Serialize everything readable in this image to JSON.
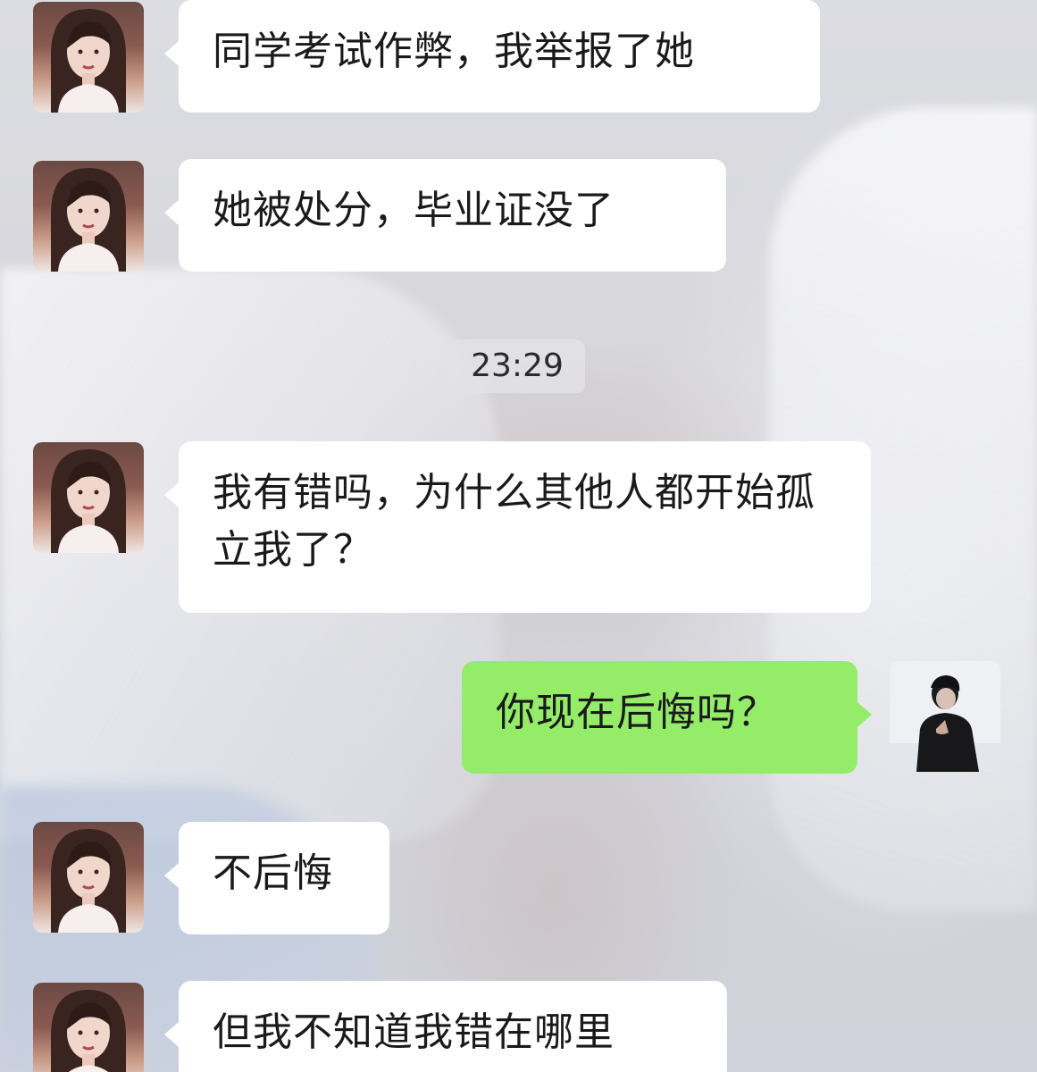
{
  "chat": {
    "messages": [
      {
        "side": "left",
        "text": "同学考试作弊，我举报了她"
      },
      {
        "side": "left",
        "text": "她被处分，毕业证没了"
      },
      {
        "side": "left",
        "text": "我有错吗，为什么其他人都开始孤立我了？"
      },
      {
        "side": "right",
        "text": "你现在后悔吗？"
      },
      {
        "side": "left",
        "text": "不后悔"
      },
      {
        "side": "left",
        "text": "但我不知道我错在哪里"
      }
    ],
    "timestamp": "23:29"
  },
  "colors": {
    "incoming_bubble": "#ffffff",
    "outgoing_bubble": "#95ec69",
    "timestamp_bg": "#e2e2e6"
  },
  "icons": {
    "contact_avatar": "contact-avatar-icon",
    "user_avatar": "user-avatar-icon"
  }
}
